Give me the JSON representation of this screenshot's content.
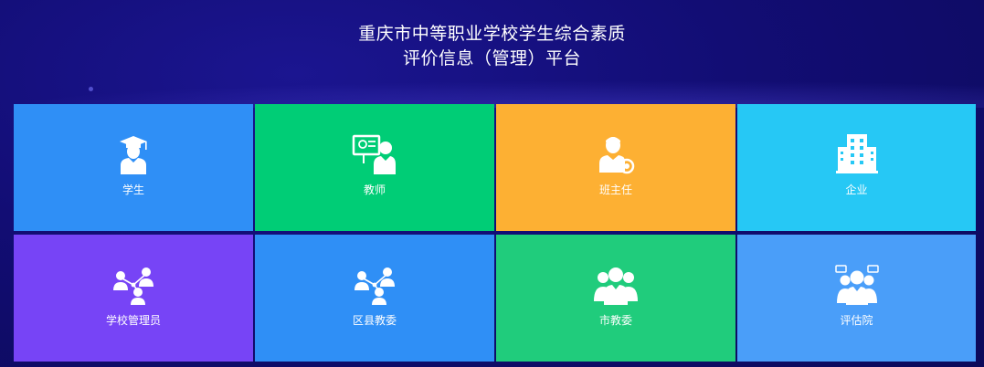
{
  "header": {
    "title_line1": "重庆市中等职业学校学生综合素质",
    "title_line2": "评价信息（管理）平台"
  },
  "tiles": [
    {
      "label": "学生",
      "color": "#2f8ff6",
      "icon": "student-icon"
    },
    {
      "label": "教师",
      "color": "#00cd76",
      "icon": "teacher-icon"
    },
    {
      "label": "班主任",
      "color": "#fdb033",
      "icon": "head-teacher-icon"
    },
    {
      "label": "企业",
      "color": "#26c8f5",
      "icon": "building-icon"
    },
    {
      "label": "学校管理员",
      "color": "#7744f6",
      "icon": "school-admin-icon"
    },
    {
      "label": "区县教委",
      "color": "#2f8ff6",
      "icon": "district-committee-icon"
    },
    {
      "label": "市教委",
      "color": "#20cc7c",
      "icon": "city-committee-icon"
    },
    {
      "label": "评估院",
      "color": "#4a9ef9",
      "icon": "assessment-institute-icon"
    }
  ]
}
